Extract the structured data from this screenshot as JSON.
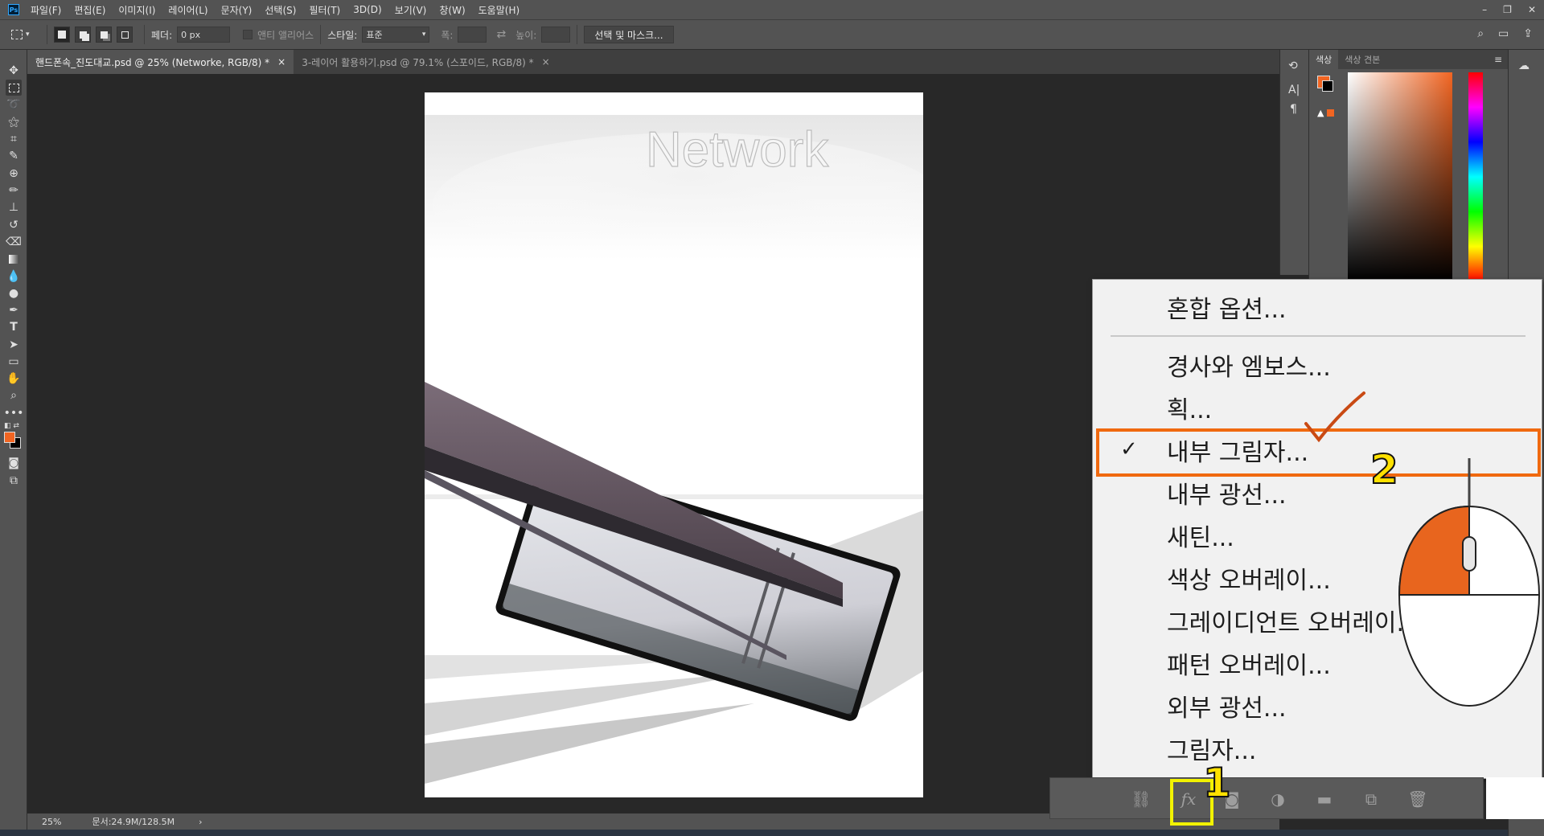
{
  "app": {
    "logo": "Ps"
  },
  "menubar": {
    "items": [
      "파일(F)",
      "편집(E)",
      "이미지(I)",
      "레이어(L)",
      "문자(Y)",
      "선택(S)",
      "필터(T)",
      "3D(D)",
      "보기(V)",
      "창(W)",
      "도움말(H)"
    ],
    "window_buttons": [
      "–",
      "❐",
      "✕"
    ]
  },
  "options": {
    "feather_label": "페더:",
    "feather_value": "0 px",
    "antialias_label": "앤티 앨리어스",
    "style_label": "스타일:",
    "style_value": "표준",
    "width_label": "폭:",
    "height_label": "높이:",
    "select_mask_label": "선택 및 마스크..."
  },
  "tabs": [
    {
      "label": "핸드폰속_진도대교.psd @ 25% (Networke, RGB/8) *",
      "close": "×"
    },
    {
      "label": "3-레이어 활용하기.psd @ 79.1% (스포이드, RGB/8) *",
      "close": "×"
    }
  ],
  "artboard": {
    "headline": "Network"
  },
  "status": {
    "zoom": "25%",
    "doc_info": "문서:24.9M/128.5M",
    "arrow": "›"
  },
  "color_panel": {
    "tab_color": "색상",
    "tab_swatches": "색상 견본"
  },
  "colors": {
    "foreground": "#f26522",
    "background": "#000000",
    "accent_highlight": "#f0690f",
    "fx_highlight": "#f2f200"
  },
  "context_menu": {
    "items": [
      "혼합 옵션...",
      "경사와 엠보스...",
      "획...",
      "내부 그림자...",
      "내부 광선...",
      "새틴...",
      "색상 오버레이...",
      "그레이디언트 오버레이...",
      "패턴 오버레이...",
      "외부 광선...",
      "그림자..."
    ],
    "checked_index": 3,
    "checkmark": "✓"
  },
  "layers_bar": {
    "icons": [
      "link-icon",
      "fx-icon",
      "mask-icon",
      "adjustment-icon",
      "folder-icon",
      "new-layer-icon",
      "trash-icon"
    ],
    "fx_label": "fx"
  },
  "annotations": {
    "step1": "1",
    "step2": "2"
  }
}
